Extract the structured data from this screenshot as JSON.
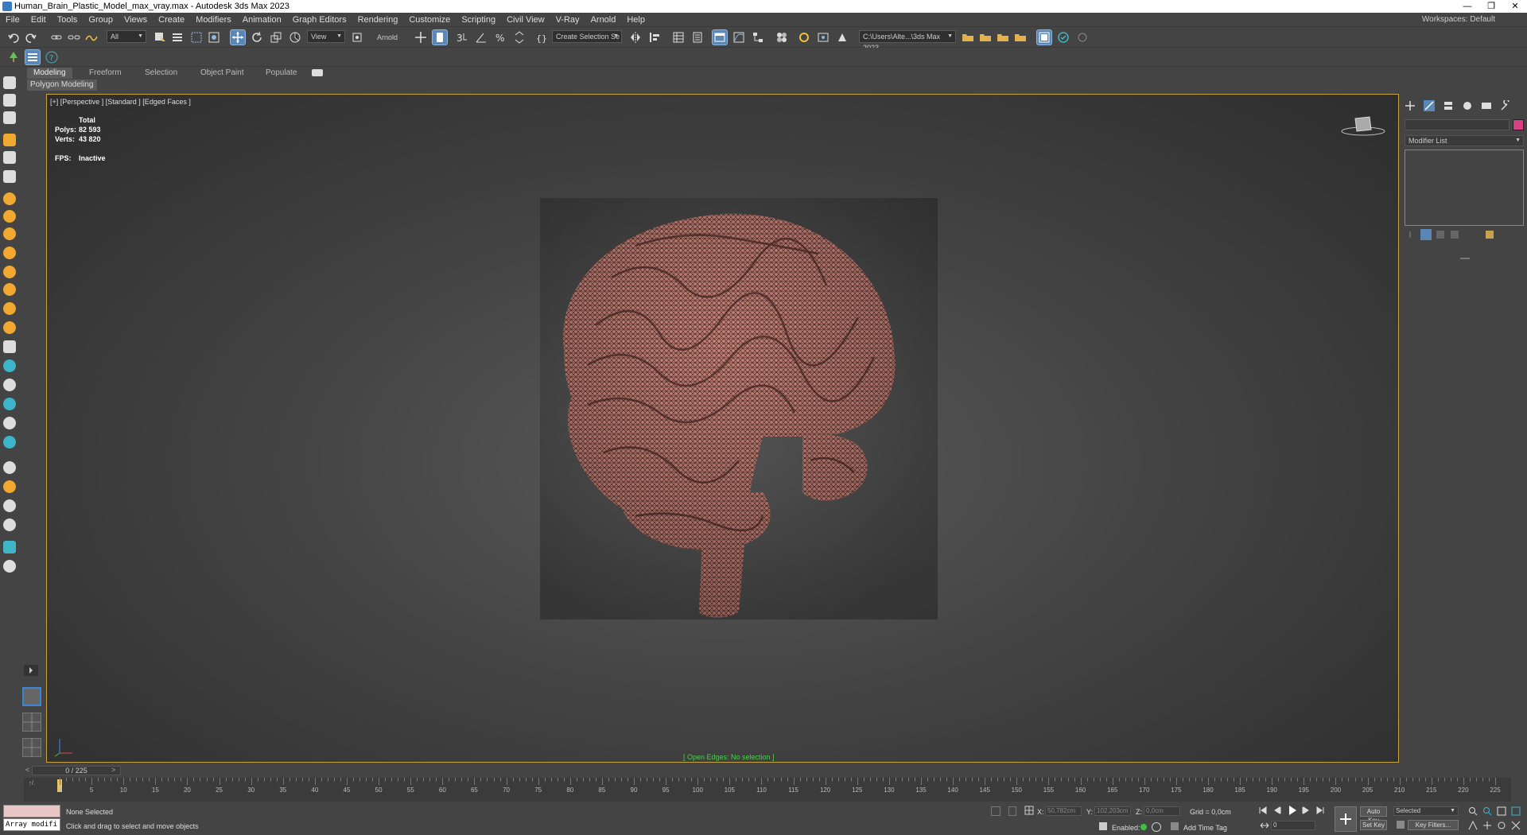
{
  "window": {
    "title": "Human_Brain_Plastic_Model_max_vray.max - Autodesk 3ds Max 2023"
  },
  "menu": [
    "File",
    "Edit",
    "Tools",
    "Group",
    "Views",
    "Create",
    "Modifiers",
    "Animation",
    "Graph Editors",
    "Rendering",
    "Customize",
    "Scripting",
    "Civil View",
    "V-Ray",
    "Arnold",
    "Help"
  ],
  "workspace": {
    "label": "Workspaces:",
    "value": "Default"
  },
  "toolbar": {
    "selection_filter": "All",
    "coord_system": "View",
    "renderer_label": "Arnold",
    "selection_set": "Create Selection Se",
    "project_path": "C:\\Users\\Alte...\\3ds Max 2023"
  },
  "ribbon": {
    "tabs": [
      "Modeling",
      "Freeform",
      "Selection",
      "Object Paint",
      "Populate"
    ],
    "active": "Modeling",
    "sub_label": "Polygon Modeling"
  },
  "viewport": {
    "label": "[+] [Perspective ] [Standard ] [Edged Faces ]",
    "stats": {
      "header": "Total",
      "polys_label": "Polys:",
      "polys": "82 593",
      "verts_label": "Verts:",
      "verts": "43 820",
      "fps_label": "FPS:",
      "fps": "Inactive"
    },
    "open_edges": "[ Open Edges: No selection ]"
  },
  "command_panel": {
    "modifier_list": "Modifier List",
    "color": "#d7417f"
  },
  "timeline": {
    "counter": "0 / 225",
    "ticks": [
      "0",
      "5",
      "10",
      "15",
      "20",
      "25",
      "30",
      "35",
      "40",
      "45",
      "50",
      "55",
      "60",
      "65",
      "70",
      "75",
      "80",
      "85",
      "90",
      "95",
      "100",
      "105",
      "110",
      "115",
      "120",
      "125",
      "130",
      "135",
      "140",
      "145",
      "150",
      "155",
      "160",
      "165",
      "170",
      "175",
      "180",
      "185",
      "190",
      "195",
      "200",
      "205",
      "210",
      "215",
      "220",
      "225"
    ]
  },
  "status": {
    "maxscript": "Array modifi",
    "selection": "None Selected",
    "prompt": "Click and drag to select and move objects",
    "x_label": "X:",
    "x": "50,782cm",
    "y_label": "Y:",
    "y": "102,203cm",
    "z_label": "Z:",
    "z": "0,0cm",
    "grid": "Grid = 0,0cm",
    "enabled_label": "Enabled:",
    "add_time_tag": "Add Time Tag",
    "auto_key": "Auto Key",
    "set_key": "Set Key",
    "selected": "Selected",
    "key_filters": "Key Filters...",
    "frame": "0"
  }
}
